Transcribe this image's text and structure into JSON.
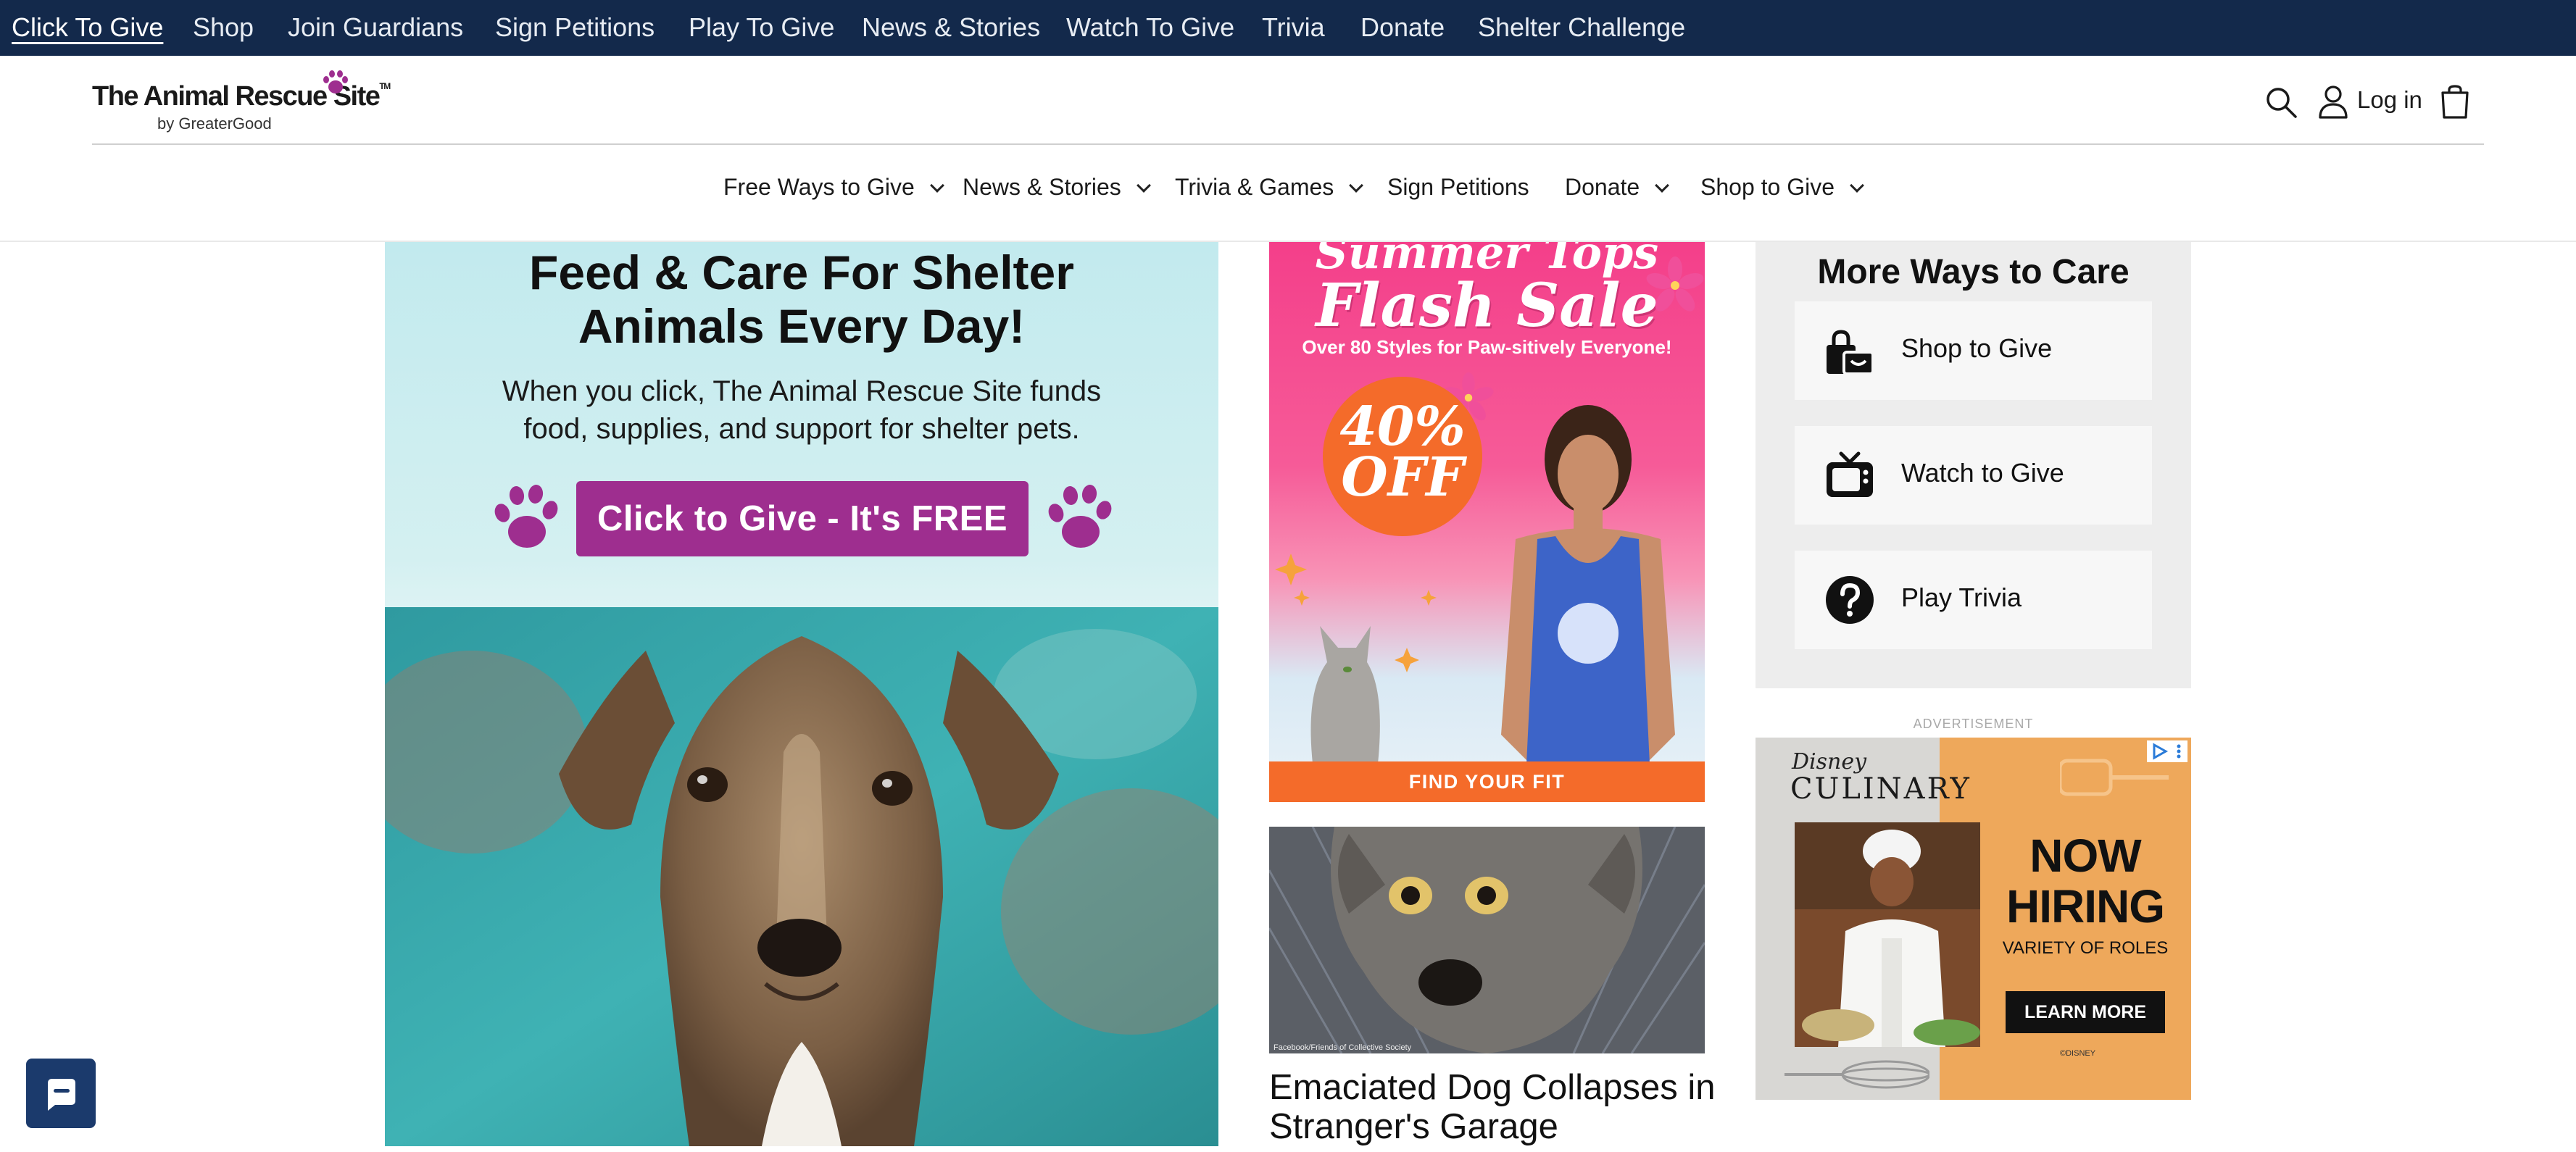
{
  "topbar": {
    "links": [
      {
        "label": "Click To Give",
        "active": true
      },
      {
        "label": "Shop"
      },
      {
        "label": "Join Guardians"
      },
      {
        "label": "Sign Petitions"
      },
      {
        "label": "Play To Give"
      },
      {
        "label": "News & Stories"
      },
      {
        "label": "Watch To Give"
      },
      {
        "label": "Trivia"
      },
      {
        "label": "Donate"
      },
      {
        "label": "Shelter Challenge"
      }
    ]
  },
  "header": {
    "logo": {
      "name": "The Animal Rescue Site",
      "tm": "TM",
      "sub": "by GreaterGood"
    },
    "login_label": "Log in",
    "icons": [
      "search-icon",
      "account-icon",
      "cart-icon"
    ]
  },
  "mainnav": {
    "items": [
      {
        "label": "Free Ways to Give",
        "dropdown": true
      },
      {
        "label": "News & Stories",
        "dropdown": true
      },
      {
        "label": "Trivia & Games",
        "dropdown": true
      },
      {
        "label": "Sign Petitions",
        "dropdown": false
      },
      {
        "label": "Donate",
        "dropdown": true
      },
      {
        "label": "Shop to Give",
        "dropdown": true
      }
    ]
  },
  "hero": {
    "title_line1": "Feed & Care For Shelter",
    "title_line2": "Animals Every Day!",
    "sub_line1": "When you click, The Animal Rescue Site funds",
    "sub_line2": "food, supplies, and support for shelter pets.",
    "cta_label": "Click to Give - It's FREE",
    "cta_color": "#9e2e8f",
    "paw_color": "#9e2e8f"
  },
  "summer_ad": {
    "title_line1": "Summer Tops",
    "title_line2": "Flash Sale",
    "subtitle": "Over 80 Styles for Paw-sitively Everyone!",
    "badge_pct": "40%",
    "badge_off": "OFF",
    "cta": "FIND YOUR FIT",
    "accent": "#f46b2a"
  },
  "news": {
    "credit": "Facebook/Friends of Collective Society",
    "title_line1": "Emaciated Dog Collapses in",
    "title_line2": "Stranger's Garage"
  },
  "more_ways": {
    "title": "More Ways to Care",
    "items": [
      {
        "label": "Shop to Give",
        "icon": "shopping-bags-icon"
      },
      {
        "label": "Watch to Give",
        "icon": "tv-icon"
      },
      {
        "label": "Play Trivia",
        "icon": "question-circle-icon"
      }
    ]
  },
  "ad": {
    "label": "ADVERTISEMENT",
    "brand": "Disney",
    "brand_line": "CULINARY",
    "headline1": "NOW",
    "headline2": "HIRING",
    "roles": "VARIETY OF ROLES",
    "cta": "LEARN MORE",
    "copyright": "©DISNEY"
  }
}
